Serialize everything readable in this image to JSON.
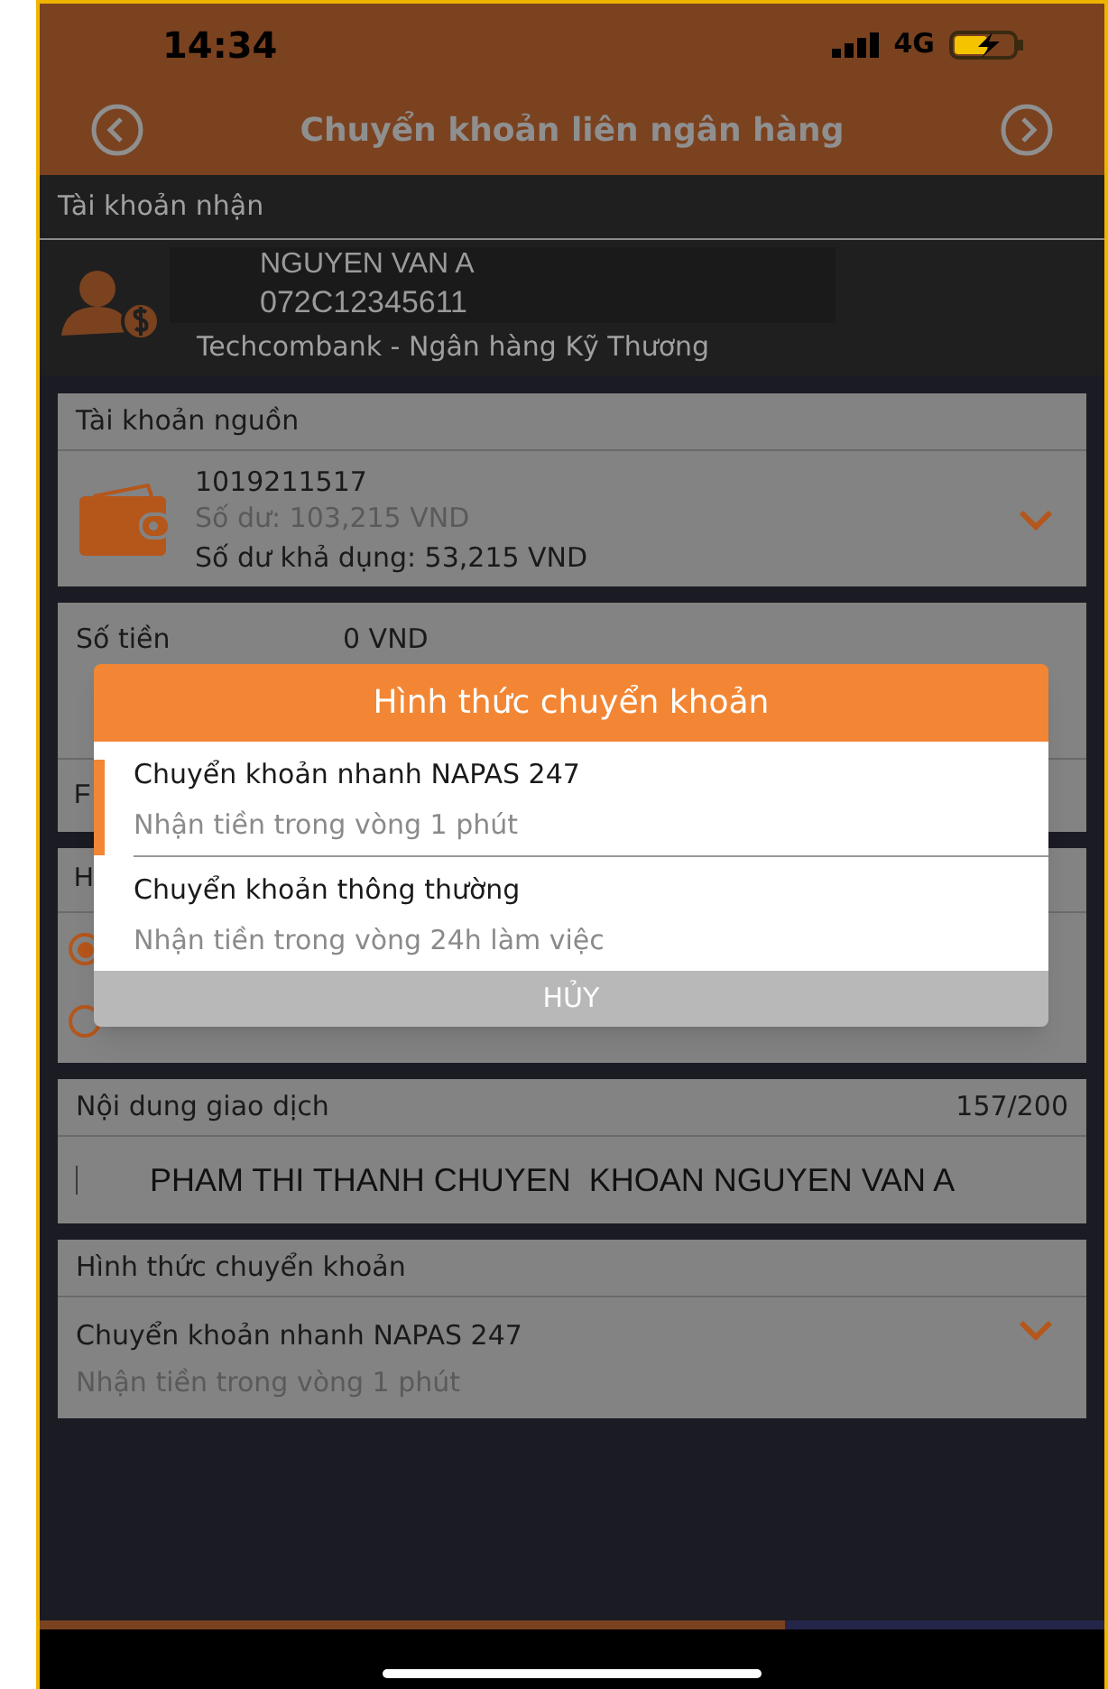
{
  "status_bar": {
    "time": "14:34",
    "network": "4G"
  },
  "header": {
    "title": "Chuyển khoản liên ngân hàng"
  },
  "recipient": {
    "label": "Tài khoản nhận",
    "name": "NGUYEN VAN A",
    "account": "072C12345611",
    "bank": "Techcombank - Ngân hàng Kỹ Thương"
  },
  "source_account": {
    "label": "Tài khoản nguồn",
    "number": "1019211517",
    "balance": "Số dư: 103,215 VND",
    "available": "Số dư khả dụng: 53,215 VND"
  },
  "amount": {
    "label": "Số tiền",
    "value": "0 VND",
    "row_2_label": "F"
  },
  "fee": {
    "label": "H",
    "options": [
      {
        "selected": true
      },
      {
        "selected": false
      }
    ]
  },
  "content": {
    "label": "Nội dung giao dịch",
    "counter": "157/200",
    "value": "PHAM THI THANH CHUYEN  KHOAN NGUYEN VAN A"
  },
  "transfer_type": {
    "label": "Hình thức chuyển khoản",
    "value": "Chuyển khoản nhanh NAPAS 247",
    "note": "Nhận tiền trong vòng 1 phút"
  },
  "dialog": {
    "title": "Hình thức chuyển khoản",
    "options": [
      {
        "title": "Chuyển khoản nhanh NAPAS 247",
        "note": "Nhận tiền trong vòng 1 phút",
        "selected": true
      },
      {
        "title": "Chuyển khoản thông thường",
        "note": "Nhận tiền trong vòng 24h làm việc",
        "selected": false
      }
    ],
    "cancel": "HỦY"
  },
  "progress": {
    "level": 0.7
  }
}
